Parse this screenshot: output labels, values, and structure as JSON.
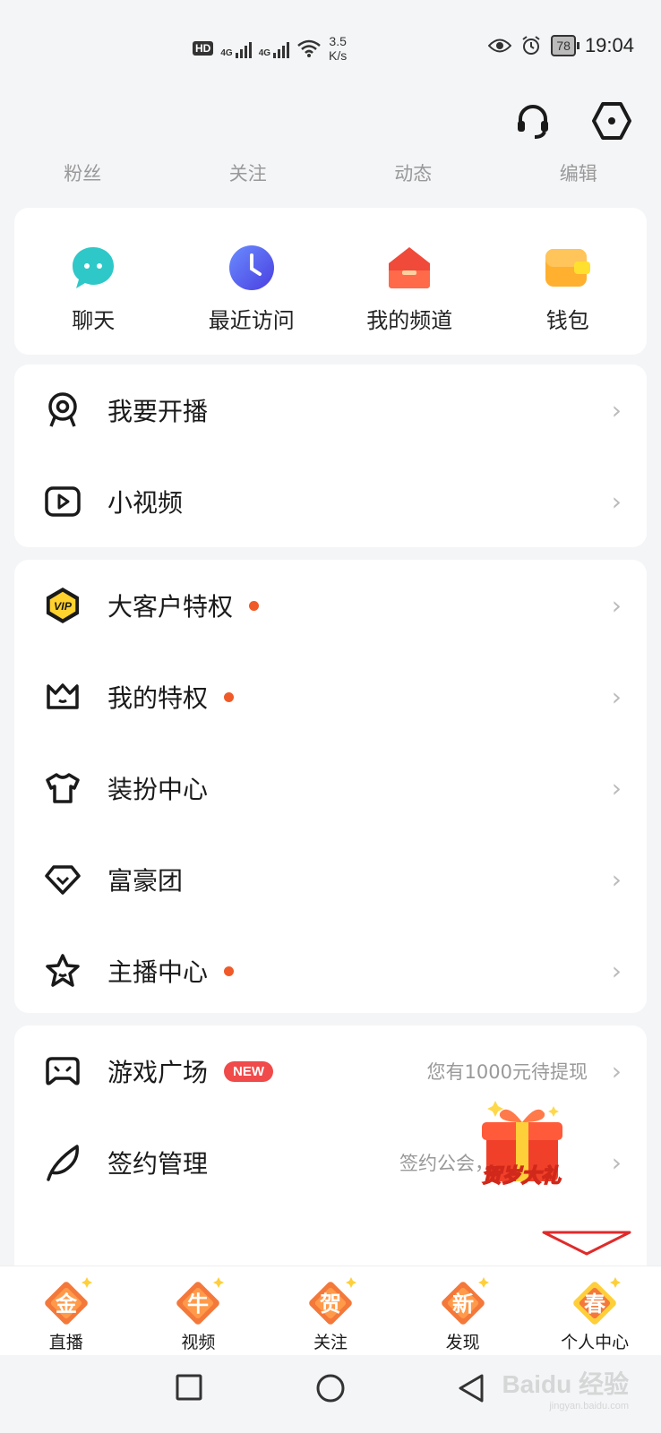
{
  "status_bar": {
    "hd": "HD",
    "sim1": "4G",
    "sim2": "4G",
    "speed_value": "3.5",
    "speed_unit": "K/s",
    "battery": "78",
    "time": "19:04"
  },
  "header_icons": {
    "support": "headset-icon",
    "settings": "hexagon-settings-icon"
  },
  "stats": [
    "粉丝",
    "关注",
    "动态",
    "编辑"
  ],
  "quick_actions": [
    {
      "label": "聊天",
      "icon": "chat-bubble-icon",
      "color": "#2ec8c8"
    },
    {
      "label": "最近访问",
      "icon": "clock-icon",
      "color": "#4a66ee"
    },
    {
      "label": "我的频道",
      "icon": "house-channel-icon",
      "color": "#f04a3a"
    },
    {
      "label": "钱包",
      "icon": "wallet-icon",
      "color": "#ffb02e"
    }
  ],
  "group1": [
    {
      "label": "我要开播",
      "icon": "webcam-icon"
    },
    {
      "label": "小视频",
      "icon": "play-video-icon"
    }
  ],
  "group2": [
    {
      "label": "大客户特权",
      "icon": "vip-badge-icon",
      "dot": true
    },
    {
      "label": "我的特权",
      "icon": "crown-icon",
      "dot": true
    },
    {
      "label": "装扮中心",
      "icon": "tshirt-icon",
      "dot": false
    },
    {
      "label": "富豪团",
      "icon": "diamond-icon",
      "dot": false
    },
    {
      "label": "主播中心",
      "icon": "star-icon",
      "dot": true
    }
  ],
  "group3": [
    {
      "label": "游戏广场",
      "icon": "gamepad-icon",
      "badge": "NEW",
      "aside": "您有1000元待提现"
    },
    {
      "label": "签约管理",
      "icon": "feather-icon",
      "aside": "签约公会，获"
    }
  ],
  "promo": {
    "text": "贺岁大礼"
  },
  "tabs": [
    {
      "label": "直播",
      "glyph": "金"
    },
    {
      "label": "视频",
      "glyph": "牛"
    },
    {
      "label": "关注",
      "glyph": "贺"
    },
    {
      "label": "发现",
      "glyph": "新"
    },
    {
      "label": "个人中心",
      "glyph": "春"
    }
  ],
  "colors": {
    "accent_orange": "#f05a28",
    "tab_orange": "#f4783a",
    "tab_yellow": "#ffcf3a",
    "badge_red": "#f04a4a"
  },
  "watermark": {
    "brand": "Baidu 经验",
    "site": "jingyan.baidu.com"
  }
}
